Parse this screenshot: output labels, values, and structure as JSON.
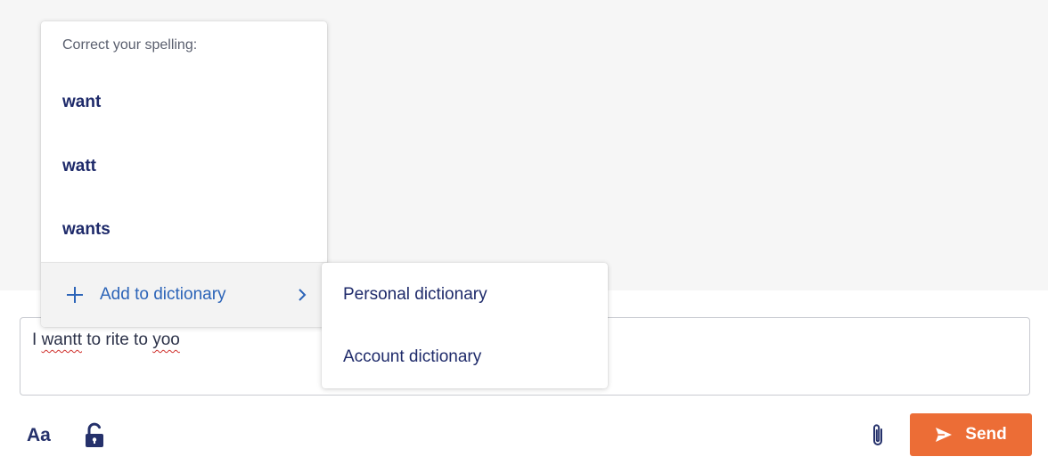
{
  "composer": {
    "segments": [
      {
        "text": "I ",
        "misspelled": false
      },
      {
        "text": "wantt",
        "misspelled": true
      },
      {
        "text": " to rite to ",
        "misspelled": false
      },
      {
        "text": "yoo",
        "misspelled": true
      }
    ]
  },
  "toolbar": {
    "format_label": "Aa",
    "lock_icon": "unlocked-padlock-icon",
    "attach_icon": "paperclip-icon",
    "send_label": "Send",
    "send_icon": "paper-plane-icon",
    "send_color": "#ec6d36"
  },
  "spell_menu": {
    "header": "Correct your spelling:",
    "suggestions": [
      "want",
      "watt",
      "wants"
    ],
    "add_to_dictionary_label": "Add to dictionary",
    "link_color": "#2c64b8",
    "text_color": "#1e2a6a"
  },
  "dictionary_submenu": {
    "items": [
      "Personal dictionary",
      "Account dictionary"
    ]
  }
}
